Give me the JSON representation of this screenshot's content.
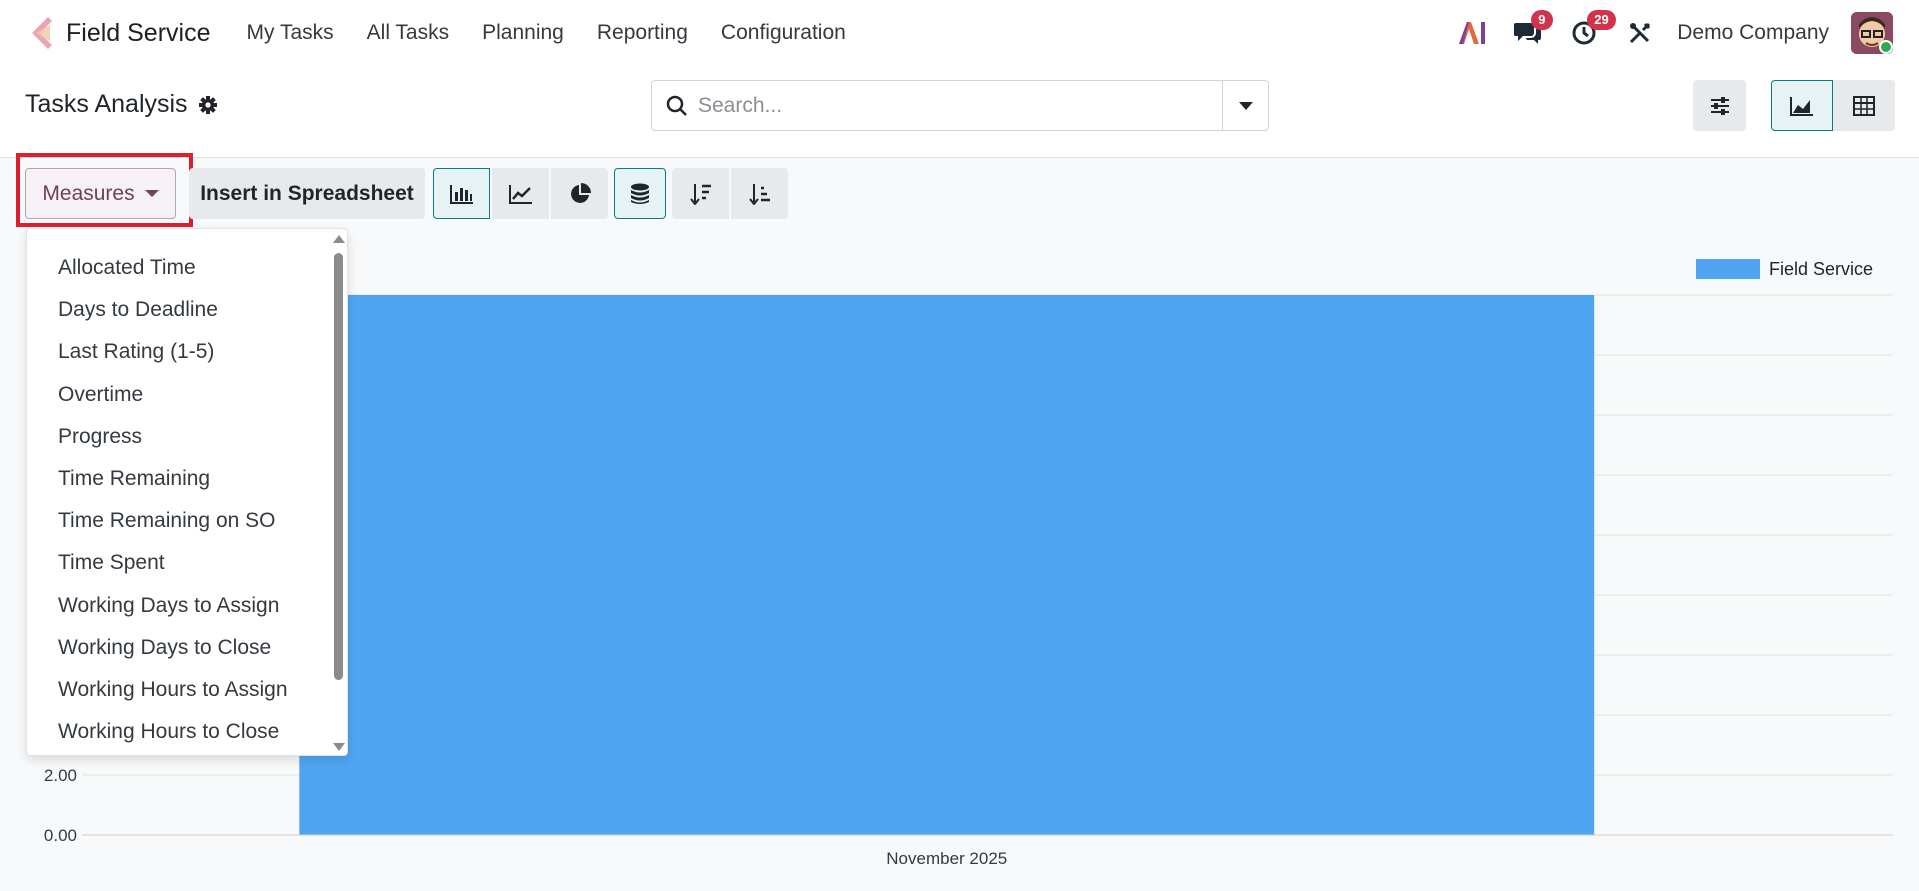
{
  "navbar": {
    "app_name": "Field Service",
    "menu": [
      "My Tasks",
      "All Tasks",
      "Planning",
      "Reporting",
      "Configuration"
    ],
    "messages_count": "9",
    "activities_count": "29",
    "company": "Demo Company"
  },
  "control_panel": {
    "title": "Tasks Analysis",
    "search_placeholder": "Search..."
  },
  "toolbar": {
    "measures_label": "Measures",
    "insert_label": "Insert in Spreadsheet"
  },
  "measures_menu": {
    "items": [
      "Allocated Time",
      "Days to Deadline",
      "Last Rating (1-5)",
      "Overtime",
      "Progress",
      "Time Remaining",
      "Time Remaining on SO",
      "Time Spent",
      "Working Days to Assign",
      "Working Days to Close",
      "Working Hours to Assign",
      "Working Hours to Close"
    ]
  },
  "colors": {
    "brand": "#71405b",
    "accent": "#017e84",
    "bar": "#4fa5f2",
    "highlight": "#dc1f2f",
    "badge": "#d0334b"
  },
  "chart_data": {
    "type": "bar",
    "categories": [
      "November 2025"
    ],
    "series": [
      {
        "name": "Field Service",
        "values": [
          18
        ]
      }
    ],
    "yticks": [
      "0.00",
      "2.00"
    ],
    "ylim": [
      0,
      18
    ],
    "grid": true,
    "legend": "top-right"
  }
}
